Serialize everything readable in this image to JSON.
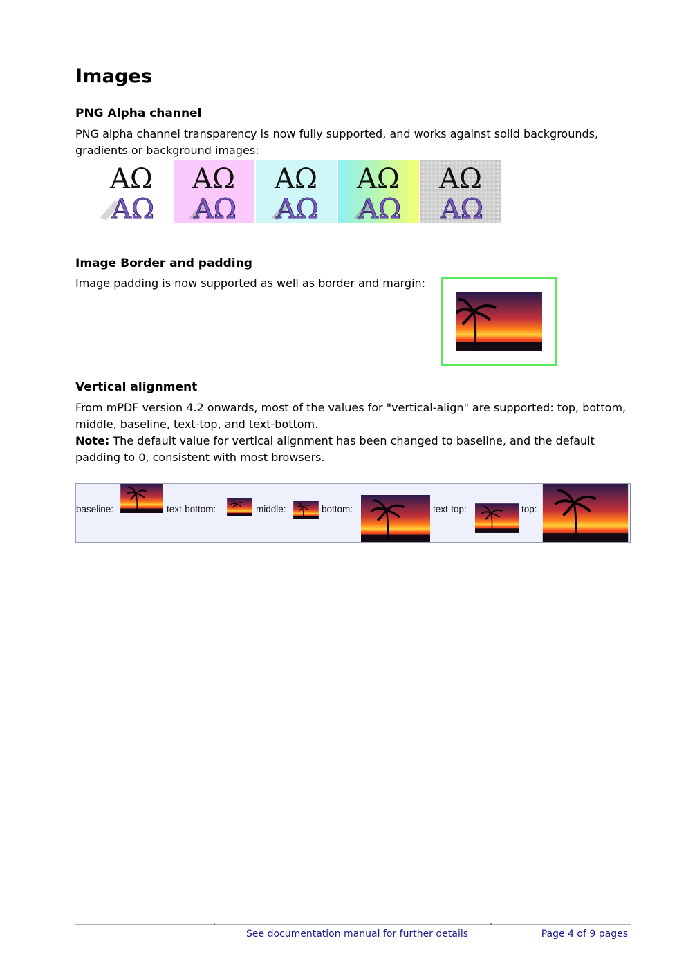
{
  "title": "Images",
  "png_section": {
    "heading": "PNG Alpha channel",
    "text": "PNG alpha channel transparency is now fully supported, and works against solid backgrounds, gradients or background images:",
    "tiles": [
      {
        "glyphs_top": "AΩ",
        "glyphs_bottom": "AΩ"
      },
      {
        "glyphs_top": "AΩ",
        "glyphs_bottom": "AΩ"
      },
      {
        "glyphs_top": "AΩ",
        "glyphs_bottom": "AΩ"
      },
      {
        "glyphs_top": "AΩ",
        "glyphs_bottom": "AΩ"
      },
      {
        "glyphs_top": "AΩ",
        "glyphs_bottom": "AΩ"
      }
    ],
    "colors": {
      "tile2_bg": "#fbc8fb",
      "tile3_bg": "#cff7f7",
      "glyph_top": "#111111",
      "glyph_bottom": "#7b5cc4"
    }
  },
  "border_section": {
    "heading": "Image Border and padding",
    "text": "Image padding is now supported as well as border and margin:",
    "border_color": "#5be85b"
  },
  "valign_section": {
    "heading": "Vertical alignment",
    "text_line1": "From mPDF version 4.2 onwards, most of the values for \"vertical-align\" are supported: top, bottom, middle, baseline, text-top, and text-bottom.",
    "note_label": "Note:",
    "note_text": " The default value for vertical alignment has been changed to baseline, and the default padding to 0, consistent with most browsers.",
    "labels": {
      "baseline": "baseline:",
      "text_bottom": "text-bottom:",
      "middle": "middle:",
      "bottom": "bottom:",
      "text_top": "text-top:",
      "top": "top:"
    }
  },
  "footer": {
    "see": "See ",
    "link": "documentation manual",
    "rest": " for further details",
    "page": "Page 4 of 9 pages"
  }
}
